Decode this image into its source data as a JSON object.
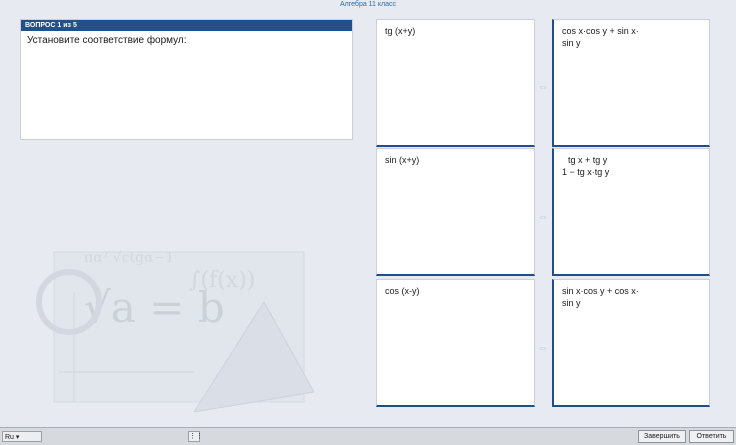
{
  "window": {
    "title": "Алгебра 11 класс"
  },
  "question": {
    "counter": "ВОПРОС 1 из 5",
    "text": "Установите соответствие формул:"
  },
  "pairs": [
    {
      "left": "tg (x+y)",
      "right": "cos x·cos y + sin x·sin y"
    },
    {
      "left": "sin (x+y)",
      "right": "tg x + tg y / 1 − tg x·tg y"
    },
    {
      "left": "cos (x-y)",
      "right": "sin x·cos y + cos x·sin y"
    }
  ],
  "right_lines": [
    [
      "cos x·cos y + sin x·",
      "sin y"
    ],
    [
      "tg x + tg y",
      "1 − tg x·tg y"
    ],
    [
      "sin x·cos y + cos x·",
      "sin y"
    ]
  ],
  "statusbar": {
    "language": "Ru ▾",
    "grid_icon": "⋮⋮",
    "buttons": [
      "Завершить",
      "Ответить"
    ]
  },
  "icons": {
    "match_arrow": "double-arrow-icon",
    "watermark": "math-scroll-watermark"
  },
  "colors": {
    "accent": "#22508a",
    "card_border": "#1f4f88",
    "arrow": "#b9c8e0"
  }
}
